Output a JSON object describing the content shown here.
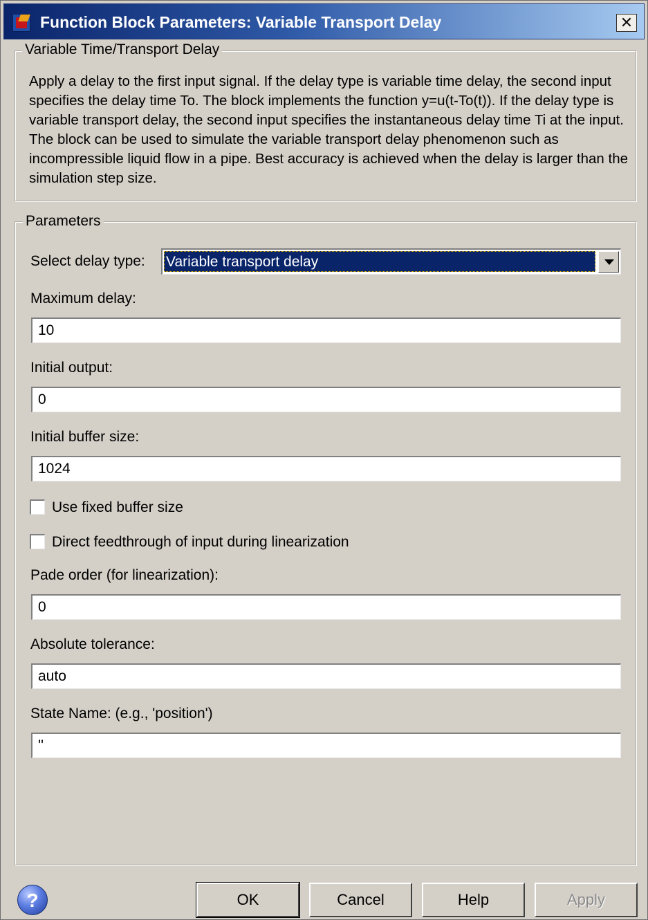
{
  "window": {
    "title": "Function Block Parameters: Variable Transport Delay",
    "close_label": "✕"
  },
  "description_group": {
    "legend": "Variable Time/Transport Delay",
    "text": "Apply a delay to the first input signal.  If the delay type is variable time delay, the second input specifies the delay time To. The block implements the function y=u(t-To(t)). If the delay type is variable transport delay, the second input specifies the instantaneous delay time Ti at the input. The block can be used to simulate the variable transport delay phenomenon such as incompressible liquid flow in a pipe. Best accuracy is achieved when the delay is larger than the simulation step size."
  },
  "parameters": {
    "legend": "Parameters",
    "delay_type": {
      "label": "Select delay type:",
      "value": "Variable transport delay"
    },
    "maximum_delay": {
      "label": "Maximum delay:",
      "value": "10"
    },
    "initial_output": {
      "label": "Initial output:",
      "value": "0"
    },
    "initial_buffer_size": {
      "label": "Initial buffer size:",
      "value": "1024"
    },
    "use_fixed_buffer": {
      "label": "Use fixed buffer size",
      "checked": false
    },
    "direct_feedthrough": {
      "label": "Direct feedthrough of input during linearization",
      "checked": false
    },
    "pade_order": {
      "label": "Pade order (for linearization):",
      "value": "0"
    },
    "absolute_tolerance": {
      "label": "Absolute tolerance:",
      "value": "auto"
    },
    "state_name": {
      "label": "State Name: (e.g., 'position')",
      "value": "''"
    }
  },
  "buttons": {
    "help_icon": "?",
    "ok": "OK",
    "cancel": "Cancel",
    "help": "Help",
    "apply": "Apply"
  },
  "icons": {
    "app": "simulink-block-icon",
    "close": "close-icon",
    "help": "help-question-icon"
  }
}
